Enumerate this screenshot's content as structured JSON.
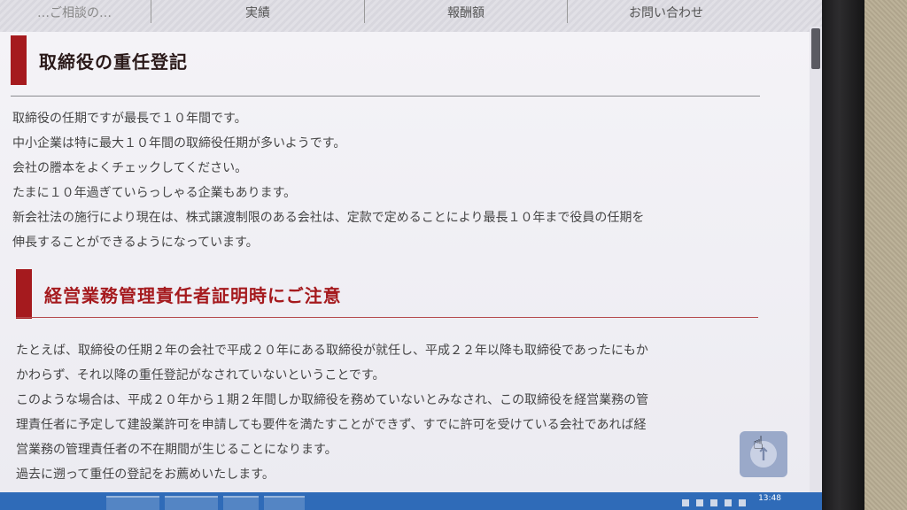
{
  "nav": {
    "items": [
      "",
      "実績",
      "報酬額",
      "お問い合わせ"
    ],
    "partial_left": "…ご相談の…"
  },
  "sections": [
    {
      "heading": "取締役の重任登記",
      "lines": [
        "取締役の任期ですが最長で１０年間です。",
        "中小企業は特に最大１０年間の取締役任期が多いようです。",
        "会社の謄本をよくチェックしてください。",
        "たまに１０年過ぎていらっしゃる企業もあります。",
        "新会社法の施行により現在は、株式譲渡制限のある会社は、定款で定めることにより最長１０年まで役員の任期を",
        "伸長することができるようになっています。"
      ]
    },
    {
      "heading": "経営業務管理責任者証明時にご注意",
      "lines": [
        "たとえば、取締役の任期２年の会社で平成２０年にある取締役が就任し、平成２２年以降も取締役であったにもか",
        "かわらず、それ以降の重任登記がなされていないということです。",
        "このような場合は、平成２０年から１期２年間しか取締役を務めていないとみなされ、この取締役を経営業務の管",
        "理責任者に予定して建設業許可を申請しても要件を満たすことができず、すでに許可を受けている会社であれば経",
        "営業務の管理責任者の不在期間が生じることになります。",
        "過去に遡って重任の登記をお薦めいたします。"
      ]
    }
  ],
  "taskbar": {
    "clock": "13:48"
  },
  "colors": {
    "accent": "#a51a1e",
    "heading1_text": "#2b1a1a",
    "heading2_text": "#a51a1e",
    "taskbar": "#2f6bb8"
  },
  "icons": {
    "back_to_top": "arrow-up-icon",
    "cursor": "hand-cursor-icon"
  }
}
